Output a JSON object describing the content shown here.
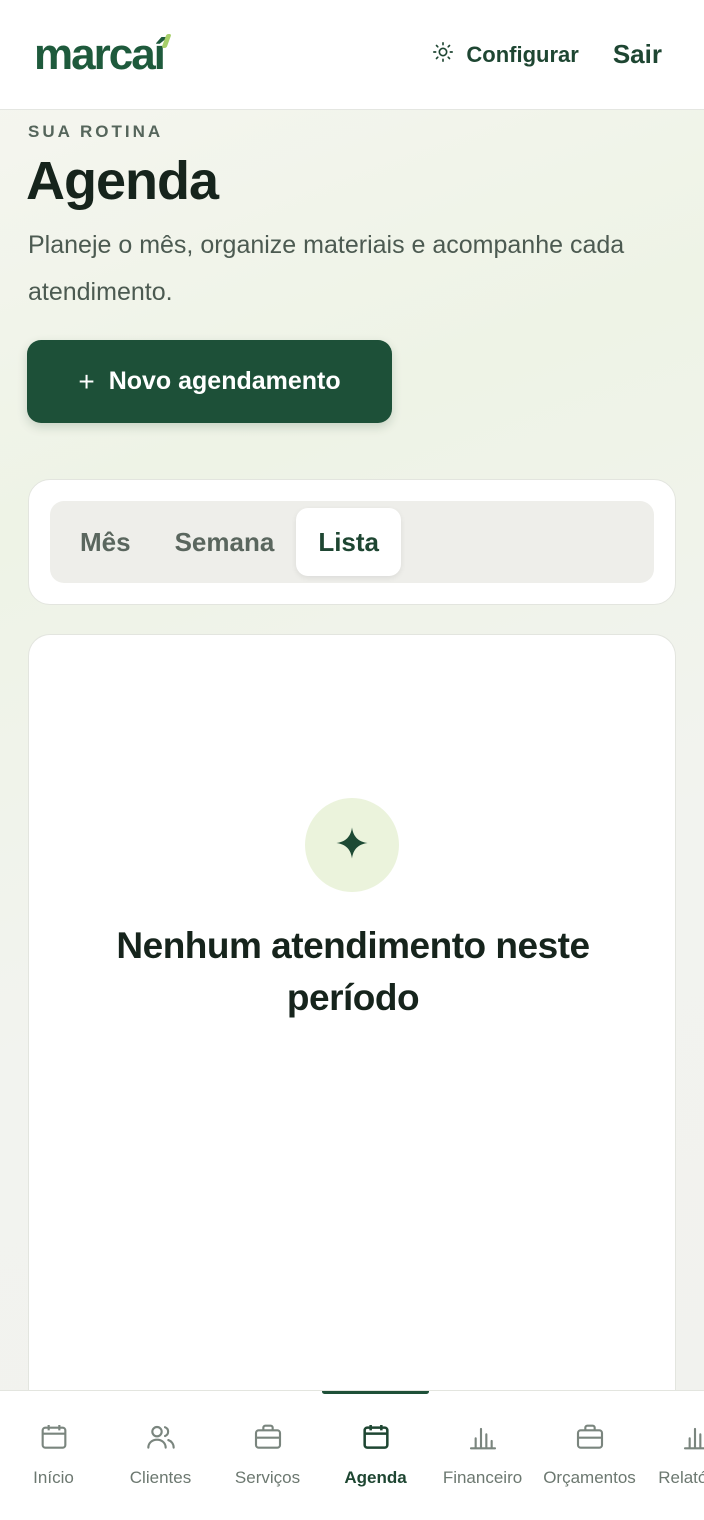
{
  "header": {
    "logo": "marcaí",
    "logo_main": "marca",
    "logo_accent": "í",
    "config_label": "Configurar",
    "logout_label": "Sair"
  },
  "hero": {
    "eyebrow": "SUA ROTINA",
    "title": "Agenda",
    "description": "Planeje o mês, organize materiais e acompanhe cada atendimento.",
    "new_button_icon": "+",
    "new_button_label": "Novo agendamento"
  },
  "view_tabs": [
    {
      "label": "Mês",
      "active": false
    },
    {
      "label": "Semana",
      "active": false
    },
    {
      "label": "Lista",
      "active": true
    }
  ],
  "empty_state": {
    "icon": "sparkle-icon",
    "title": "Nenhum atendimento neste período"
  },
  "bottom_nav": [
    {
      "label": "Início",
      "icon": "calendar-icon",
      "active": false
    },
    {
      "label": "Clientes",
      "icon": "users-icon",
      "active": false
    },
    {
      "label": "Serviços",
      "icon": "briefcase-icon",
      "active": false
    },
    {
      "label": "Agenda",
      "icon": "calendar-icon",
      "active": true
    },
    {
      "label": "Financeiro",
      "icon": "bar-chart-icon",
      "active": false
    },
    {
      "label": "Orçamentos",
      "icon": "briefcase-icon",
      "active": false
    },
    {
      "label": "Relatórios",
      "icon": "bar-chart-icon",
      "active": false
    }
  ],
  "colors": {
    "brand": "#1d5038",
    "accent": "#a7cf6a",
    "empty_icon_bg": "#ebf3dc"
  }
}
